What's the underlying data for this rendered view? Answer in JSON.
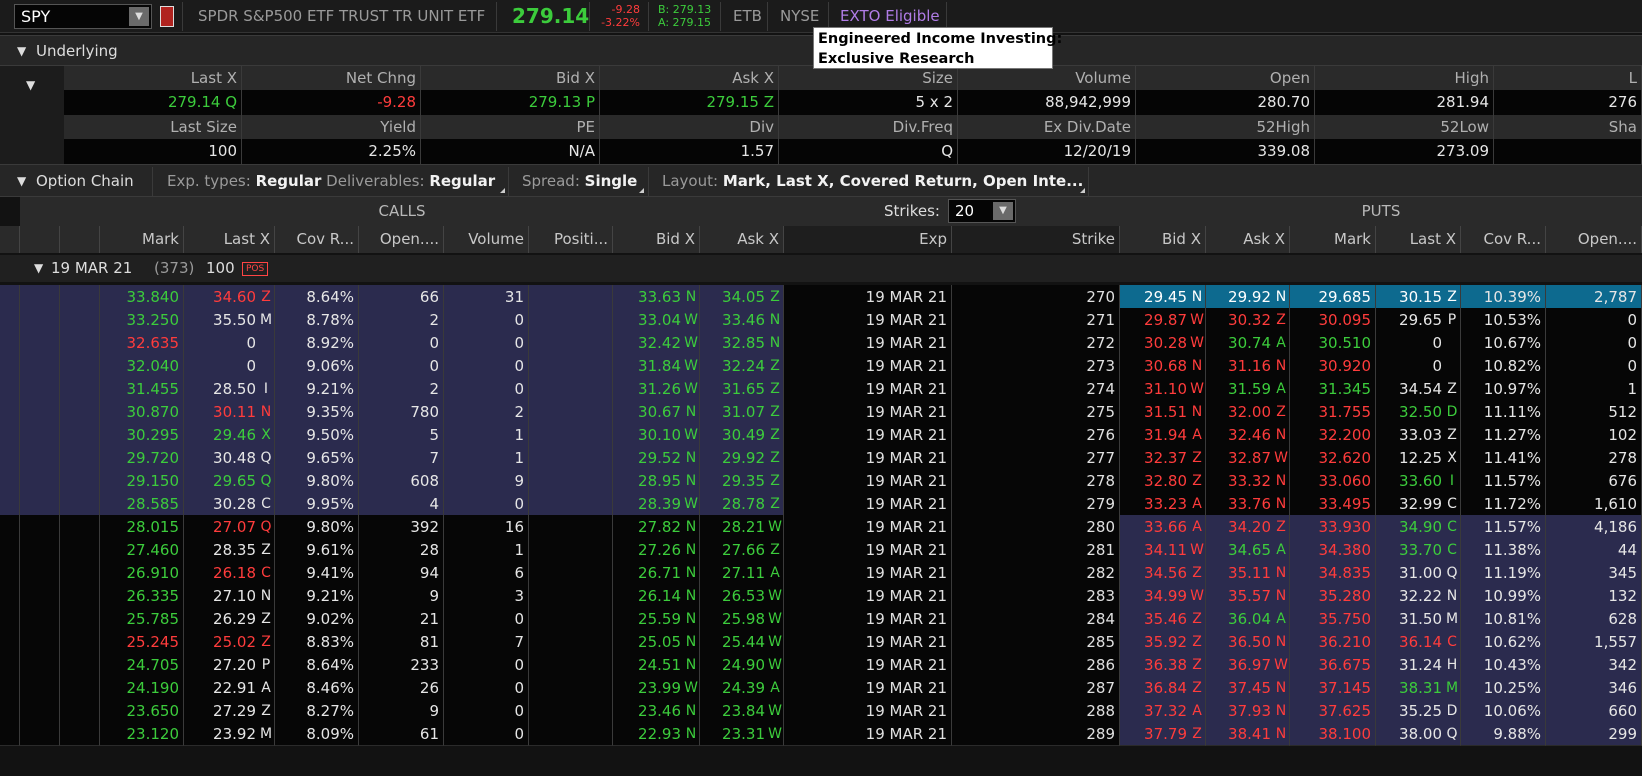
{
  "symbol": "SPY",
  "description": "SPDR S&P500 ETF TRUST TR UNIT ETF",
  "price": "279.14",
  "net_change": "-9.28",
  "pct_change": "-3.22%",
  "bid_quote": "B: 279.13",
  "ask_quote": "A: 279.15",
  "etb": "ETB",
  "exchange": "NYSE",
  "exto": "EXTO Eligible",
  "annotation": {
    "line1": "Engineered Income Investing:",
    "line2": "Exclusive Research"
  },
  "underlying": {
    "title": "Underlying",
    "headers1": [
      "Last X",
      "Net Chng",
      "Bid X",
      "Ask X",
      "Size",
      "Volume",
      "Open",
      "High",
      "L"
    ],
    "values1": [
      "279.14 Q",
      "-9.28",
      "279.13 P",
      "279.15 Z",
      "5 x 2",
      "88,942,999",
      "280.70",
      "281.94",
      "276"
    ],
    "headers2": [
      "Last Size",
      "Yield",
      "PE",
      "Div",
      "Div.Freq",
      "Ex Div.Date",
      "52High",
      "52Low",
      "Sha"
    ],
    "values2": [
      "100",
      "2.25%",
      "N/A",
      "1.57",
      "Q",
      "12/20/19",
      "339.08",
      "273.09",
      ""
    ]
  },
  "option_chain": {
    "title": "Option Chain",
    "exp_types_label": "Exp. types:",
    "exp_types_value": "Regular",
    "deliverables_label": "Deliverables:",
    "deliverables_value": "Regular",
    "spread_label": "Spread:",
    "spread_value": "Single",
    "layout_label": "Layout:",
    "layout_value": "Mark, Last X, Covered Return, Open Inte...",
    "calls_label": "CALLS",
    "puts_label": "PUTS",
    "strikes_label": "Strikes:",
    "strikes_value": "20",
    "call_headers": [
      "Mark",
      "Last X",
      "Cov R...",
      "Open....",
      "Volume",
      "Positi...",
      "Bid X",
      "Ask X"
    ],
    "center_headers": [
      "Exp",
      "Strike"
    ],
    "put_headers": [
      "Bid X",
      "Ask X",
      "Mark",
      "Last X",
      "Cov R...",
      "Open...."
    ],
    "expiration": {
      "label": "19 MAR 21",
      "count": "(373)",
      "multiplier": "100",
      "badge": "POS"
    },
    "rows": [
      {
        "mark": "33.840",
        "mc": "g",
        "last": "34.60",
        "lx": "Z",
        "lc": "r",
        "cov": "8.64%",
        "oi": "66",
        "vol": "31",
        "bid": "33.63",
        "bx": "N",
        "ask": "34.05",
        "ax": "Z",
        "exp": "19 MAR 21",
        "strike": "270",
        "pbid": "29.45",
        "pbx": "N",
        "pask": "29.92",
        "pax": "N",
        "pmark": "29.685",
        "pmc": "w",
        "plast": "30.15",
        "plx": "Z",
        "plc": "w",
        "pcov": "10.39%",
        "poi": "2,787"
      },
      {
        "mark": "33.250",
        "mc": "g",
        "last": "35.50",
        "lx": "M",
        "lc": "w",
        "cov": "8.78%",
        "oi": "2",
        "vol": "0",
        "bid": "33.04",
        "bx": "W",
        "ask": "33.46",
        "ax": "N",
        "exp": "19 MAR 21",
        "strike": "271",
        "pbid": "29.87",
        "pbx": "W",
        "pask": "30.32",
        "pax": "Z",
        "pmark": "30.095",
        "pmc": "r",
        "plast": "29.65",
        "plx": "P",
        "plc": "w",
        "pcov": "10.53%",
        "poi": "0"
      },
      {
        "mark": "32.635",
        "mc": "r",
        "last": "0",
        "lx": "",
        "lc": "w",
        "cov": "8.92%",
        "oi": "0",
        "vol": "0",
        "bid": "32.42",
        "bx": "W",
        "ask": "32.85",
        "ax": "N",
        "exp": "19 MAR 21",
        "strike": "272",
        "pbid": "30.28",
        "pbx": "W",
        "pask": "30.74",
        "pax": "A",
        "pmark": "30.510",
        "pmc": "g",
        "plast": "0",
        "plx": "",
        "plc": "w",
        "pcov": "10.67%",
        "poi": "0"
      },
      {
        "mark": "32.040",
        "mc": "g",
        "last": "0",
        "lx": "",
        "lc": "w",
        "cov": "9.06%",
        "oi": "0",
        "vol": "0",
        "bid": "31.84",
        "bx": "W",
        "ask": "32.24",
        "ax": "Z",
        "exp": "19 MAR 21",
        "strike": "273",
        "pbid": "30.68",
        "pbx": "N",
        "pask": "31.16",
        "pax": "N",
        "pmark": "30.920",
        "pmc": "r",
        "plast": "0",
        "plx": "",
        "plc": "w",
        "pcov": "10.82%",
        "poi": "0"
      },
      {
        "mark": "31.455",
        "mc": "g",
        "last": "28.50",
        "lx": "I",
        "lc": "w",
        "cov": "9.21%",
        "oi": "2",
        "vol": "0",
        "bid": "31.26",
        "bx": "W",
        "ask": "31.65",
        "ax": "Z",
        "exp": "19 MAR 21",
        "strike": "274",
        "pbid": "31.10",
        "pbx": "W",
        "pask": "31.59",
        "pax": "A",
        "pmark": "31.345",
        "pmc": "g",
        "plast": "34.54",
        "plx": "Z",
        "plc": "w",
        "pcov": "10.97%",
        "poi": "1"
      },
      {
        "mark": "30.870",
        "mc": "g",
        "last": "30.11",
        "lx": "N",
        "lc": "r",
        "cov": "9.35%",
        "oi": "780",
        "vol": "2",
        "bid": "30.67",
        "bx": "N",
        "ask": "31.07",
        "ax": "Z",
        "exp": "19 MAR 21",
        "strike": "275",
        "pbid": "31.51",
        "pbx": "N",
        "pask": "32.00",
        "pax": "Z",
        "pmark": "31.755",
        "pmc": "r",
        "plast": "32.50",
        "plx": "D",
        "plc": "g",
        "pcov": "11.11%",
        "poi": "512"
      },
      {
        "mark": "30.295",
        "mc": "g",
        "last": "29.46",
        "lx": "X",
        "lc": "g",
        "cov": "9.50%",
        "oi": "5",
        "vol": "1",
        "bid": "30.10",
        "bx": "W",
        "ask": "30.49",
        "ax": "Z",
        "exp": "19 MAR 21",
        "strike": "276",
        "pbid": "31.94",
        "pbx": "A",
        "pask": "32.46",
        "pax": "N",
        "pmark": "32.200",
        "pmc": "r",
        "plast": "33.03",
        "plx": "Z",
        "plc": "w",
        "pcov": "11.27%",
        "poi": "102"
      },
      {
        "mark": "29.720",
        "mc": "g",
        "last": "30.48",
        "lx": "Q",
        "lc": "w",
        "cov": "9.65%",
        "oi": "7",
        "vol": "1",
        "bid": "29.52",
        "bx": "N",
        "ask": "29.92",
        "ax": "Z",
        "exp": "19 MAR 21",
        "strike": "277",
        "pbid": "32.37",
        "pbx": "Z",
        "pask": "32.87",
        "pax": "W",
        "pmark": "32.620",
        "pmc": "r",
        "plast": "12.25",
        "plx": "X",
        "plc": "w",
        "pcov": "11.41%",
        "poi": "278"
      },
      {
        "mark": "29.150",
        "mc": "g",
        "last": "29.65",
        "lx": "Q",
        "lc": "g",
        "cov": "9.80%",
        "oi": "608",
        "vol": "9",
        "bid": "28.95",
        "bx": "N",
        "ask": "29.35",
        "ax": "Z",
        "exp": "19 MAR 21",
        "strike": "278",
        "pbid": "32.80",
        "pbx": "Z",
        "pask": "33.32",
        "pax": "N",
        "pmark": "33.060",
        "pmc": "r",
        "plast": "33.60",
        "plx": "I",
        "plc": "g",
        "pcov": "11.57%",
        "poi": "676"
      },
      {
        "mark": "28.585",
        "mc": "g",
        "last": "30.28",
        "lx": "C",
        "lc": "w",
        "cov": "9.95%",
        "oi": "4",
        "vol": "0",
        "bid": "28.39",
        "bx": "W",
        "ask": "28.78",
        "ax": "Z",
        "exp": "19 MAR 21",
        "strike": "279",
        "pbid": "33.23",
        "pbx": "A",
        "pask": "33.76",
        "pax": "N",
        "pmark": "33.495",
        "pmc": "r",
        "plast": "32.99",
        "plx": "C",
        "plc": "w",
        "pcov": "11.72%",
        "poi": "1,610"
      },
      {
        "mark": "28.015",
        "mc": "g",
        "last": "27.07",
        "lx": "Q",
        "lc": "r",
        "cov": "9.80%",
        "oi": "392",
        "vol": "16",
        "bid": "27.82",
        "bx": "N",
        "ask": "28.21",
        "ax": "W",
        "exp": "19 MAR 21",
        "strike": "280",
        "pbid": "33.66",
        "pbx": "A",
        "pask": "34.20",
        "pax": "Z",
        "pmark": "33.930",
        "pmc": "r",
        "plast": "34.90",
        "plx": "C",
        "plc": "g",
        "pcov": "11.57%",
        "poi": "4,186"
      },
      {
        "mark": "27.460",
        "mc": "g",
        "last": "28.35",
        "lx": "Z",
        "lc": "w",
        "cov": "9.61%",
        "oi": "28",
        "vol": "1",
        "bid": "27.26",
        "bx": "N",
        "ask": "27.66",
        "ax": "Z",
        "exp": "19 MAR 21",
        "strike": "281",
        "pbid": "34.11",
        "pbx": "W",
        "pask": "34.65",
        "pax": "A",
        "pmark": "34.380",
        "pmc": "r",
        "plast": "33.70",
        "plx": "C",
        "plc": "g",
        "pcov": "11.38%",
        "poi": "44"
      },
      {
        "mark": "26.910",
        "mc": "g",
        "last": "26.18",
        "lx": "C",
        "lc": "r",
        "cov": "9.41%",
        "oi": "94",
        "vol": "6",
        "bid": "26.71",
        "bx": "N",
        "ask": "27.11",
        "ax": "A",
        "exp": "19 MAR 21",
        "strike": "282",
        "pbid": "34.56",
        "pbx": "Z",
        "pask": "35.11",
        "pax": "N",
        "pmark": "34.835",
        "pmc": "r",
        "plast": "31.00",
        "plx": "Q",
        "plc": "w",
        "pcov": "11.19%",
        "poi": "345"
      },
      {
        "mark": "26.335",
        "mc": "g",
        "last": "27.10",
        "lx": "N",
        "lc": "w",
        "cov": "9.21%",
        "oi": "9",
        "vol": "3",
        "bid": "26.14",
        "bx": "N",
        "ask": "26.53",
        "ax": "W",
        "exp": "19 MAR 21",
        "strike": "283",
        "pbid": "34.99",
        "pbx": "W",
        "pask": "35.57",
        "pax": "N",
        "pmark": "35.280",
        "pmc": "r",
        "plast": "32.22",
        "plx": "N",
        "plc": "w",
        "pcov": "10.99%",
        "poi": "132"
      },
      {
        "mark": "25.785",
        "mc": "g",
        "last": "26.29",
        "lx": "Z",
        "lc": "w",
        "cov": "9.02%",
        "oi": "21",
        "vol": "0",
        "bid": "25.59",
        "bx": "N",
        "ask": "25.98",
        "ax": "W",
        "exp": "19 MAR 21",
        "strike": "284",
        "pbid": "35.46",
        "pbx": "Z",
        "pask": "36.04",
        "pax": "A",
        "pmark": "35.750",
        "pmc": "r",
        "plast": "31.50",
        "plx": "M",
        "plc": "w",
        "pcov": "10.81%",
        "poi": "628"
      },
      {
        "mark": "25.245",
        "mc": "r",
        "last": "25.02",
        "lx": "Z",
        "lc": "r",
        "cov": "8.83%",
        "oi": "81",
        "vol": "7",
        "bid": "25.05",
        "bx": "N",
        "ask": "25.44",
        "ax": "W",
        "exp": "19 MAR 21",
        "strike": "285",
        "pbid": "35.92",
        "pbx": "Z",
        "pask": "36.50",
        "pax": "N",
        "pmark": "36.210",
        "pmc": "r",
        "plast": "36.14",
        "plx": "C",
        "plc": "r",
        "pcov": "10.62%",
        "poi": "1,557"
      },
      {
        "mark": "24.705",
        "mc": "g",
        "last": "27.20",
        "lx": "P",
        "lc": "w",
        "cov": "8.64%",
        "oi": "233",
        "vol": "0",
        "bid": "24.51",
        "bx": "N",
        "ask": "24.90",
        "ax": "W",
        "exp": "19 MAR 21",
        "strike": "286",
        "pbid": "36.38",
        "pbx": "Z",
        "pask": "36.97",
        "pax": "W",
        "pmark": "36.675",
        "pmc": "r",
        "plast": "31.24",
        "plx": "H",
        "plc": "w",
        "pcov": "10.43%",
        "poi": "342"
      },
      {
        "mark": "24.190",
        "mc": "g",
        "last": "22.91",
        "lx": "A",
        "lc": "w",
        "cov": "8.46%",
        "oi": "26",
        "vol": "0",
        "bid": "23.99",
        "bx": "W",
        "ask": "24.39",
        "ax": "A",
        "exp": "19 MAR 21",
        "strike": "287",
        "pbid": "36.84",
        "pbx": "Z",
        "pask": "37.45",
        "pax": "N",
        "pmark": "37.145",
        "pmc": "r",
        "plast": "38.31",
        "plx": "M",
        "plc": "g",
        "pcov": "10.25%",
        "poi": "346"
      },
      {
        "mark": "23.650",
        "mc": "g",
        "last": "27.29",
        "lx": "Z",
        "lc": "w",
        "cov": "8.27%",
        "oi": "9",
        "vol": "0",
        "bid": "23.46",
        "bx": "N",
        "ask": "23.84",
        "ax": "W",
        "exp": "19 MAR 21",
        "strike": "288",
        "pbid": "37.32",
        "pbx": "A",
        "pask": "37.93",
        "pax": "N",
        "pmark": "37.625",
        "pmc": "r",
        "plast": "35.25",
        "plx": "D",
        "plc": "w",
        "pcov": "10.06%",
        "poi": "660"
      },
      {
        "mark": "23.120",
        "mc": "g",
        "last": "23.92",
        "lx": "M",
        "lc": "w",
        "cov": "8.09%",
        "oi": "61",
        "vol": "0",
        "bid": "22.93",
        "bx": "N",
        "ask": "23.31",
        "ax": "W",
        "exp": "19 MAR 21",
        "strike": "289",
        "pbid": "37.79",
        "pbx": "Z",
        "pask": "38.41",
        "pax": "N",
        "pmark": "38.100",
        "pmc": "r",
        "plast": "38.00",
        "plx": "Q",
        "plc": "w",
        "pcov": "9.88%",
        "poi": "299"
      }
    ]
  }
}
